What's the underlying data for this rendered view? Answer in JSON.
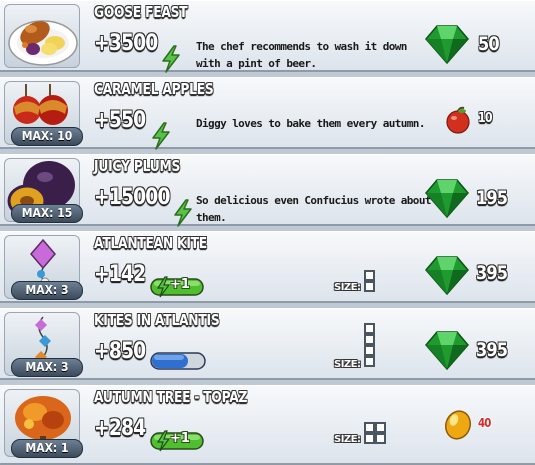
{
  "items": [
    {
      "title": "GOOSE FEAST",
      "value": "+3500",
      "description": "The chef recommends to wash it down with a pint of beer.",
      "max": "",
      "energy_icon": "lightning-bolt-icon",
      "price": "50",
      "currency_icon": "emerald-gem-icon",
      "image_icon": "roast-goose-plate-icon"
    },
    {
      "title": "CARAMEL APPLES",
      "value": "+550",
      "description": "Diggy loves to bake them every autumn.",
      "max": "MAX: 10",
      "energy_icon": "lightning-bolt-icon",
      "price": "10",
      "currency_icon": "apple-icon",
      "image_icon": "caramel-apples-icon"
    },
    {
      "title": "JUICY PLUMS",
      "value": "+15000",
      "description": "So delicious even Confucius wrote about them.",
      "max": "MAX: 15",
      "energy_icon": "lightning-bolt-icon",
      "price": "195",
      "currency_icon": "emerald-gem-icon",
      "image_icon": "plums-icon"
    },
    {
      "title": "ATLANTEAN KITE",
      "value": "+142",
      "pill_text": "+1",
      "max": "MAX: 3",
      "size_label": "SIZE:",
      "price": "395",
      "currency_icon": "emerald-gem-icon",
      "image_icon": "kite-icon"
    },
    {
      "title": "KITES IN ATLANTIS",
      "value": "+850",
      "max": "MAX: 3",
      "size_label": "SIZE:",
      "price": "395",
      "currency_icon": "emerald-gem-icon",
      "image_icon": "kite-string-icon"
    },
    {
      "title": "AUTUMN TREE - TOPAZ",
      "value": "+284",
      "pill_text": "+1",
      "max": "MAX: 1",
      "size_label": "SIZE:",
      "price": "40",
      "currency_icon": "topaz-gem-icon",
      "image_icon": "autumn-tree-icon"
    }
  ],
  "colors": {
    "emerald": "#1f9a2e",
    "bolt": "#58c247",
    "pill_green": "#4fbf2f",
    "pill_blue": "#2e6fd1",
    "price_red": "#d72a2a"
  }
}
